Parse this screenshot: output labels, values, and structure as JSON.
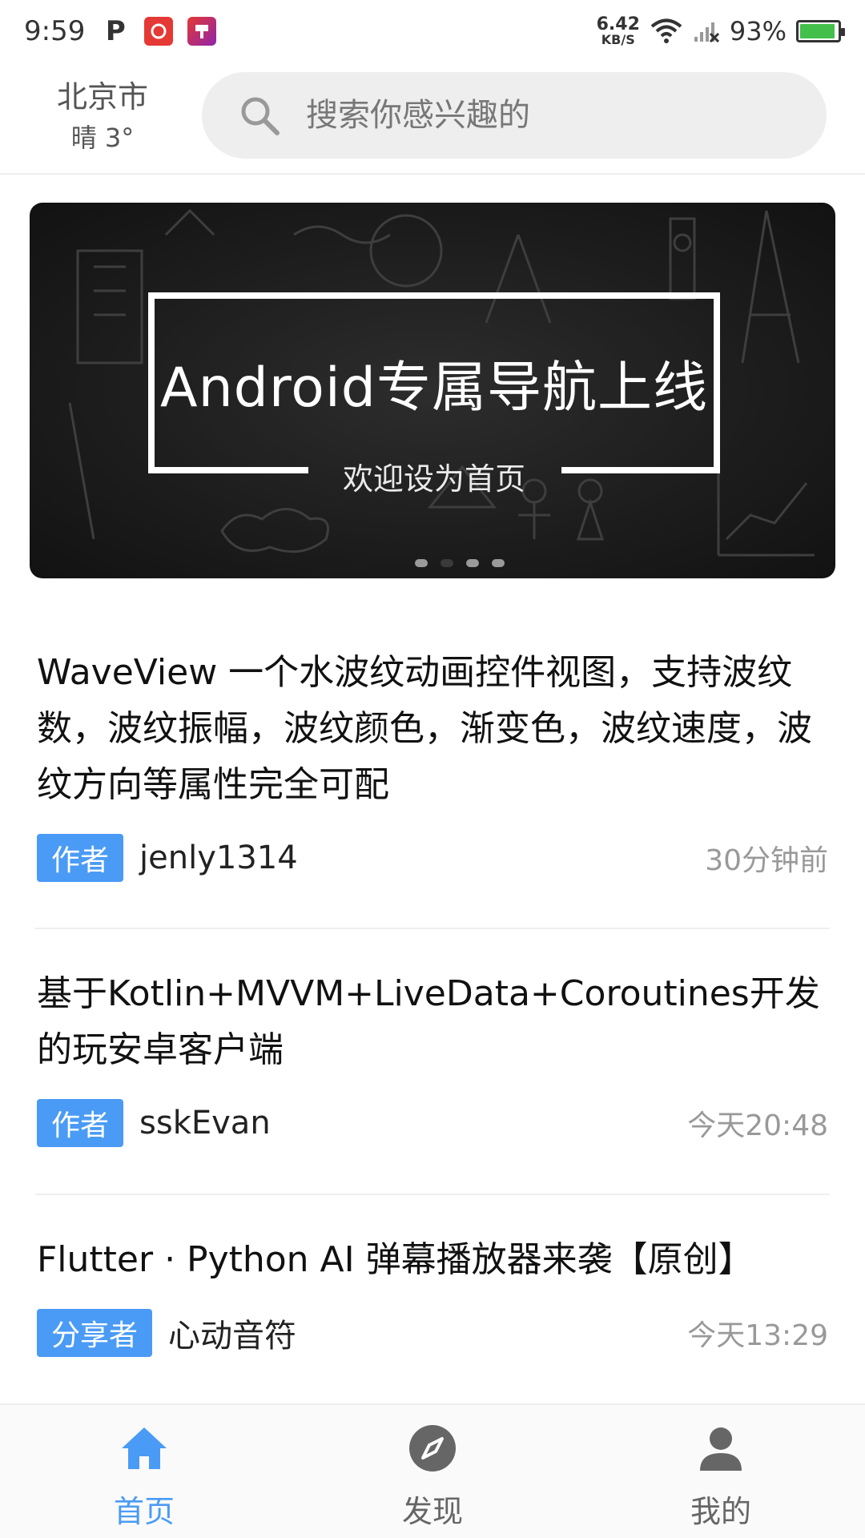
{
  "status_bar": {
    "time": "9:59",
    "net_speed_value": "6.42",
    "net_speed_unit": "KB/S",
    "battery_pct": "93%",
    "battery_level": 0.93,
    "icons": [
      "parking-icon",
      "netease-icon",
      "app-icon",
      "wifi-icon",
      "signal-icon",
      "battery-icon"
    ]
  },
  "header": {
    "city": "北京市",
    "weather": "晴 3°",
    "search_placeholder": "搜索你感兴趣的"
  },
  "banner": {
    "title": "Android专属导航上线",
    "subtitle": "欢迎设为首页",
    "slide_count": 4,
    "active_index": 1
  },
  "articles": [
    {
      "title": "WaveView 一个水波纹动画控件视图，支持波纹数，波纹振幅，波纹颜色，渐变色，波纹速度，波纹方向等属性完全可配",
      "tag": "作者",
      "author": "jenly1314",
      "time": "30分钟前"
    },
    {
      "title": "基于Kotlin+MVVM+LiveData+Coroutines开发的玩安卓客户端",
      "tag": "作者",
      "author": "sskEvan",
      "time": "今天20:48"
    },
    {
      "title": "Flutter · Python AI 弹幕播放器来袭【原创】",
      "tag": "分享者",
      "author": "心动音符",
      "time": "今天13:29"
    }
  ],
  "bottom_nav": {
    "items": [
      {
        "label": "首页",
        "icon": "home-icon",
        "active": true
      },
      {
        "label": "发现",
        "icon": "compass-icon",
        "active": false
      },
      {
        "label": "我的",
        "icon": "person-icon",
        "active": false
      }
    ],
    "accent_color": "#4a9bf5"
  }
}
